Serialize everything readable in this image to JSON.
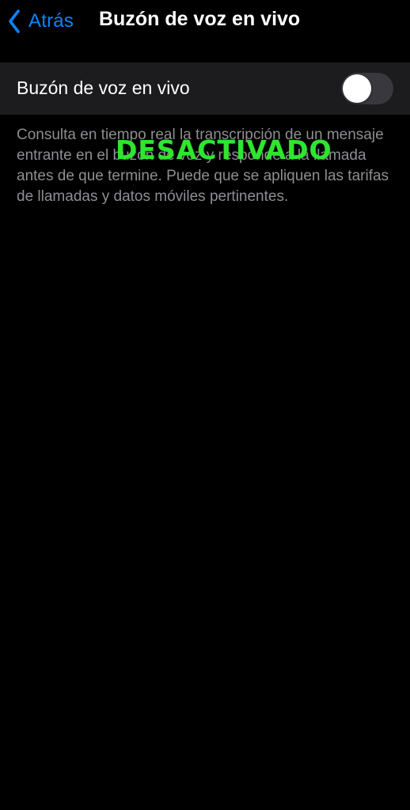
{
  "colors": {
    "accent": "#0a84ff",
    "background": "#000000",
    "row_background": "#1c1c1e",
    "toggle_off": "#39393d",
    "footer_text": "#8e8e93",
    "overlay": "#2ee62e"
  },
  "nav": {
    "back_icon": "chevron-left-icon",
    "back_label": "Atrás",
    "title": "Buzón de voz en vivo"
  },
  "setting": {
    "label": "Buzón de voz en vivo",
    "enabled": false
  },
  "footer": {
    "text": "Consulta en tiempo real la transcripción de un mensaje entrante en el buzón de voz y responde a la llamada antes de que termine. Puede que se apliquen las tarifas de llamadas y datos móviles pertinentes."
  },
  "overlay": {
    "text": "DESACTIVADO"
  }
}
